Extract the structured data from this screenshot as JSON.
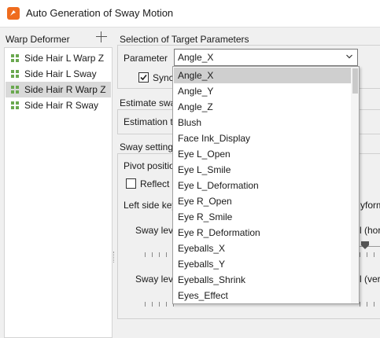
{
  "window": {
    "title": "Auto Generation of Sway Motion"
  },
  "left_panel": {
    "title": "Warp Deformer",
    "items": [
      {
        "label": "Side Hair L Warp Z",
        "selected": false
      },
      {
        "label": "Side Hair L Sway",
        "selected": false
      },
      {
        "label": "Side Hair R Warp Z",
        "selected": true
      },
      {
        "label": "Side Hair R Sway",
        "selected": false
      }
    ]
  },
  "target": {
    "section_title": "Selection of Target Parameters",
    "parameter_label": "Parameter",
    "parameter_value": "Angle_X",
    "sync_label": "Sync",
    "sync_checked": true
  },
  "estimate": {
    "section_title": "Estimate swa",
    "estimation_label": "Estimation t"
  },
  "sway": {
    "section_title": "Sway setting",
    "pivot_label": "Pivot positio",
    "reflect_label": "Reflect",
    "left_side_label": "Left side key",
    "right_fragment_1": "yform",
    "sway_level_1": "Sway lev",
    "sway_level_1_right": "l (hor",
    "sway_level_2": "Sway lev",
    "sway_level_2_right": "l (ver"
  },
  "dropdown": {
    "options": [
      "Angle_X",
      "Angle_Y",
      "Angle_Z",
      "Blush",
      "Face Ink_Display",
      "Eye L_Open",
      "Eye L_Smile",
      "Eye L_Deformation",
      "Eye R_Open",
      "Eye R_Smile",
      "Eye R_Deformation",
      "Eyeballs_X",
      "Eyeballs_Y",
      "Eyeballs_Shrink",
      "Eyes_Effect"
    ],
    "selected_index": 0
  },
  "colors": {
    "accent_icon": "#ef6c1e",
    "warp_icon": "#6aa84f",
    "selection": "#d9d9d9"
  }
}
